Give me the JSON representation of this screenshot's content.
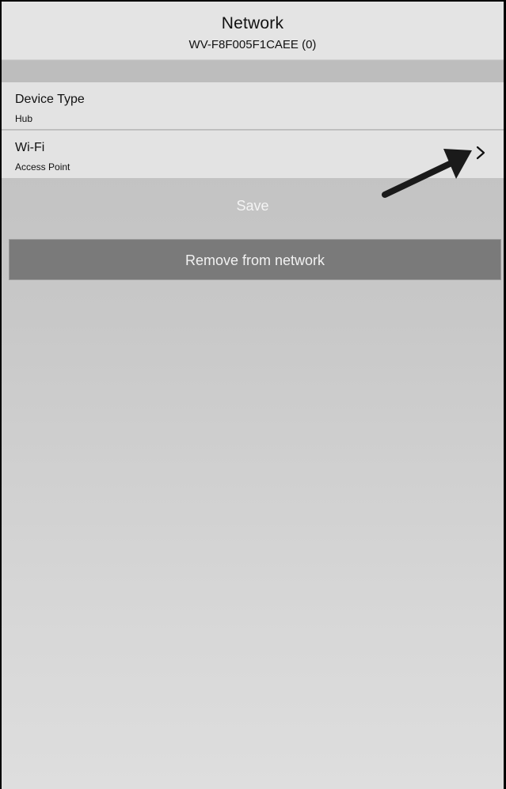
{
  "header": {
    "title": "Network",
    "subtitle": "WV-F8F005F1CAEE (0)"
  },
  "settings": {
    "device_type": {
      "label": "Device Type",
      "value": "Hub"
    },
    "wifi": {
      "label": "Wi-Fi",
      "value": "Access Point"
    }
  },
  "actions": {
    "save_label": "Save",
    "remove_label": "Remove from network"
  },
  "icons": {
    "chevron": "chevron-right-icon",
    "annotation_arrow": "arrow-icon"
  },
  "colors": {
    "header_bg": "#e4e4e4",
    "row_bg": "#e3e3e3",
    "remove_button_bg": "#7a7a7a",
    "arrow": "#1a1a1a"
  }
}
